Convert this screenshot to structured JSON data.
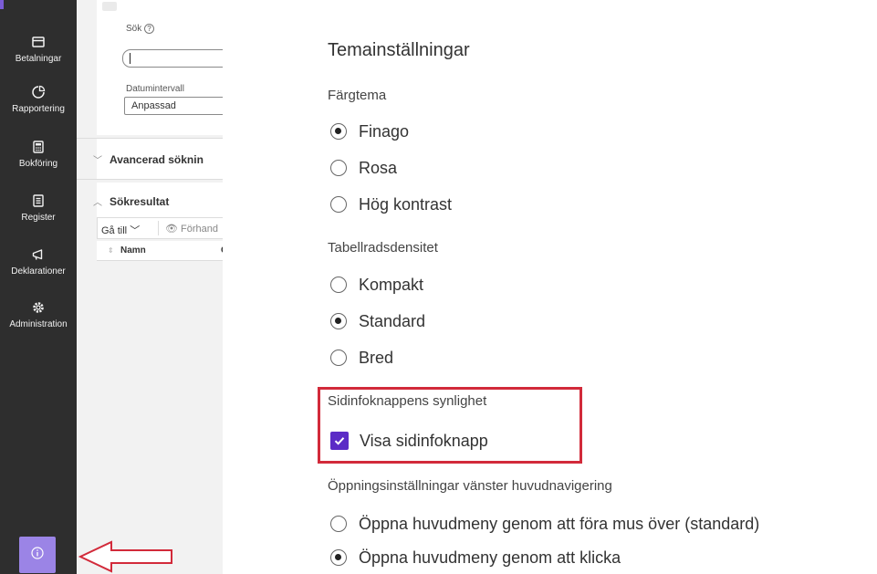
{
  "sidebar": {
    "items": [
      {
        "label": "Betalningar",
        "icon": "credit-card-icon"
      },
      {
        "label": "Rapportering",
        "icon": "pie-chart-icon"
      },
      {
        "label": "Bokföring",
        "icon": "calculator-icon"
      },
      {
        "label": "Register",
        "icon": "register-list-icon"
      },
      {
        "label": "Deklarationer",
        "icon": "megaphone-icon"
      },
      {
        "label": "Administration",
        "icon": "gear-icon"
      }
    ],
    "info_button_icon": "info-icon"
  },
  "search_panel": {
    "search_label": "Sök",
    "search_value": "",
    "date_label": "Datumintervall",
    "date_value": "Anpassad",
    "advanced_label": "Avancerad söknin",
    "results_label": "Sökresultat",
    "goto_label": "Gå till",
    "preview_label": "Förhand",
    "column_name": "Namn",
    "column_next": "C"
  },
  "settings": {
    "title": "Temainställningar",
    "color_theme": {
      "label": "Färgtema",
      "options": [
        "Finago",
        "Rosa",
        "Hög kontrast"
      ],
      "selected": "Finago"
    },
    "density": {
      "label": "Tabellradsdensitet",
      "options": [
        "Kompakt",
        "Standard",
        "Bred"
      ],
      "selected": "Standard"
    },
    "info_visibility": {
      "label": "Sidinfoknappens synlighet",
      "checkbox_label": "Visa sidinfoknapp",
      "checked": true
    },
    "nav_opening": {
      "label": "Öppningsinställningar vänster huvudnavigering",
      "options": [
        "Öppna huvudmeny genom att föra mus över (standard)",
        "Öppna huvudmeny genom att klicka"
      ],
      "selected": "Öppna huvudmeny genom att klicka"
    }
  },
  "colors": {
    "sidebar_bg": "#2e2e2e",
    "accent_purple": "#5b2bc6",
    "info_button": "#9b84e6",
    "highlight_red": "#d22a3a"
  }
}
